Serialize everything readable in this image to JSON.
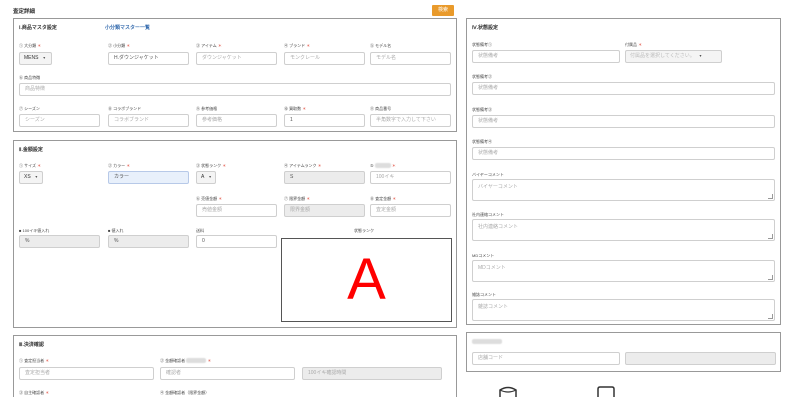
{
  "page": {
    "title": "査定詳細",
    "search_button": "検索"
  },
  "master": {
    "title": "Ⅰ.商品マスタ設定",
    "link": "小分類マスター一覧",
    "fields": [
      {
        "label": "① 大分類",
        "required": true,
        "value": "MENS",
        "kind": "select"
      },
      {
        "label": "② 小分類",
        "required": true,
        "value": "H.ダウンジャケット",
        "kind": "input"
      },
      {
        "label": "③ アイテム",
        "required": true,
        "placeholder": "ダウンジャケット",
        "kind": "input"
      },
      {
        "label": "④ ブランド",
        "required": true,
        "placeholder": "モンクレール",
        "kind": "input"
      },
      {
        "label": "⑤ モデル名",
        "required": false,
        "placeholder": "モデル名",
        "kind": "input"
      }
    ],
    "features": {
      "label": "⑥ 商品特徴",
      "placeholder": "商品特徴"
    },
    "row3": [
      {
        "label": "⑦ シーズン",
        "required": false,
        "placeholder": "シーズン"
      },
      {
        "label": "⑧ コラボブランド",
        "required": false,
        "placeholder": "コラボブランド"
      },
      {
        "label": "⑨ 参考価格",
        "required": false,
        "placeholder": "参考価格"
      },
      {
        "label": "⑩ 買取数",
        "required": true,
        "value": "1"
      },
      {
        "label": "⑪ 商品番号",
        "required": false,
        "placeholder": "半角数字で入力して下さい"
      }
    ]
  },
  "pricing": {
    "title": "Ⅱ.金額設定",
    "size": {
      "label": "① サイズ",
      "required": true,
      "value": "XS"
    },
    "color": {
      "label": "② カラー",
      "required": true,
      "placeholder": "カラー"
    },
    "rank": {
      "label": "③ 状態ランク",
      "required": true,
      "value": "A"
    },
    "item_rank": {
      "label": "④ アイテムランク",
      "required": true,
      "value": "S"
    },
    "fifth": {
      "label": "⑤",
      "required": true,
      "placeholder": "100イキ"
    },
    "sale_price": {
      "label": "⑥ 売値金額",
      "required": true,
      "placeholder": "売値金額"
    },
    "limit_price": {
      "label": "⑦ 限界金額",
      "required": true,
      "placeholder": "限界金額"
    },
    "assess_price": {
      "label": "⑧ 査定金額",
      "required": true,
      "placeholder": "査定金額"
    },
    "rate100": {
      "label": "■ 100イキ値入れ",
      "value": "%"
    },
    "rate": {
      "label": "■ 値入れ",
      "value": "%"
    },
    "shipping": {
      "label": "送料",
      "value": "0"
    },
    "rank_box": {
      "label": "状態ランク",
      "letter": "A"
    }
  },
  "approval": {
    "title": "Ⅲ.決済確認",
    "assessor": {
      "label": "① 査定担当者",
      "required": true,
      "placeholder": "査定担当者"
    },
    "checker": {
      "label": "② 金額確認者",
      "required": true,
      "placeholder": "確認者"
    },
    "check_time": {
      "placeholder": "100イキ確認時間"
    },
    "self_check": {
      "label": "③ 自主確認者",
      "required": true
    },
    "checker_limit": {
      "label": "④ 金額確認者（限界金額）"
    }
  },
  "condition": {
    "title": "Ⅳ.状態設定",
    "notes": [
      {
        "label": "状態備考①",
        "placeholder": "状態備考"
      },
      {
        "label": "状態備考②",
        "placeholder": "状態備考"
      },
      {
        "label": "状態備考③",
        "placeholder": "状態備考"
      },
      {
        "label": "状態備考④",
        "placeholder": "状態備考"
      }
    ],
    "accessory": {
      "label": "付属品",
      "required": true,
      "placeholder": "付属品を選択してください。"
    },
    "buyer": {
      "label": "バイヤーコメント",
      "placeholder": "バイヤーコメント"
    },
    "internal": {
      "label": "社内連絡コメント",
      "placeholder": "社内連絡コメント"
    },
    "md": {
      "label": "MDコメント",
      "placeholder": "MDコメント"
    },
    "kaikyo": {
      "label": "雑誌コメント",
      "placeholder": "雑誌コメント"
    }
  },
  "bottom_right": {
    "code_placeholder": "店舗コード"
  }
}
